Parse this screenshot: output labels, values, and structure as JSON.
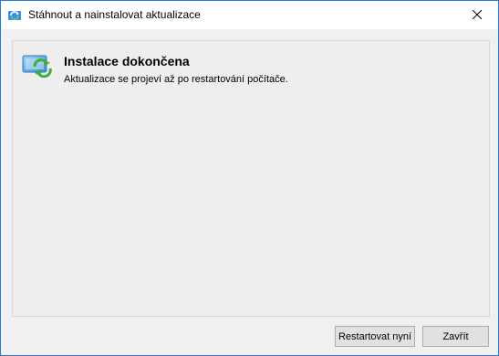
{
  "window": {
    "title": "Stáhnout a nainstalovat aktualizace",
    "icon": "windows-update-icon",
    "close_icon": "close-icon"
  },
  "status": {
    "icon": "update-complete-icon",
    "heading": "Instalace dokončena",
    "message": "Aktualizace se projeví až po restartování počítače."
  },
  "buttons": {
    "restart_label": "Restartovat nyní",
    "close_label": "Zavřít"
  },
  "colors": {
    "accent_border": "#2b79d6",
    "icon_green": "#3fae3f",
    "icon_blue": "#4aa3df"
  }
}
